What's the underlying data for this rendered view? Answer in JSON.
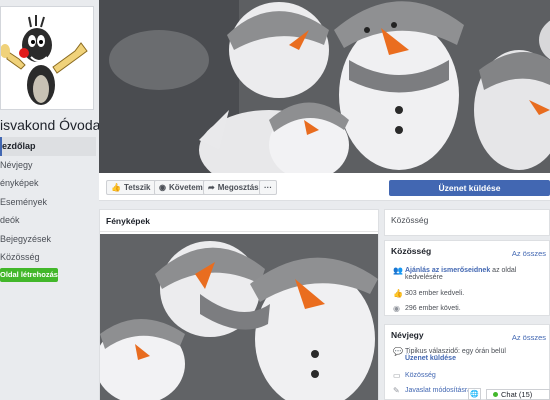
{
  "page": {
    "name": "isvakond Óvoda"
  },
  "nav": {
    "items": [
      "ezdőlap",
      "Névjegy",
      "ényképek",
      "Események",
      "deók",
      "Bejegyzések",
      "Közösség"
    ],
    "create_label": "Oldal létrehozása"
  },
  "actions": {
    "like": "Tetszik",
    "follow": "Követem",
    "share": "Megosztás",
    "more": "···",
    "message": "Üzenet küldése"
  },
  "photos": {
    "title": "Fényképek"
  },
  "community_tab": {
    "label": "Közösség"
  },
  "community": {
    "title": "Közösség",
    "see_all": "Az összes",
    "invite_link": "Ajánlás az ismerőseidnek",
    "invite_rest": "az oldal",
    "invite_line2": "kedvelésére",
    "likes": "303 ember kedveli.",
    "follows": "296 ember követi."
  },
  "about": {
    "title": "Névjegy",
    "see_all": "Az összes",
    "response": "Tipikus válaszidő: egy órán belül",
    "send_message": "Üzenet küldése",
    "category": "Közösség",
    "suggest": "Javaslat módosításra"
  },
  "chat": {
    "label": "Chat (15)"
  }
}
